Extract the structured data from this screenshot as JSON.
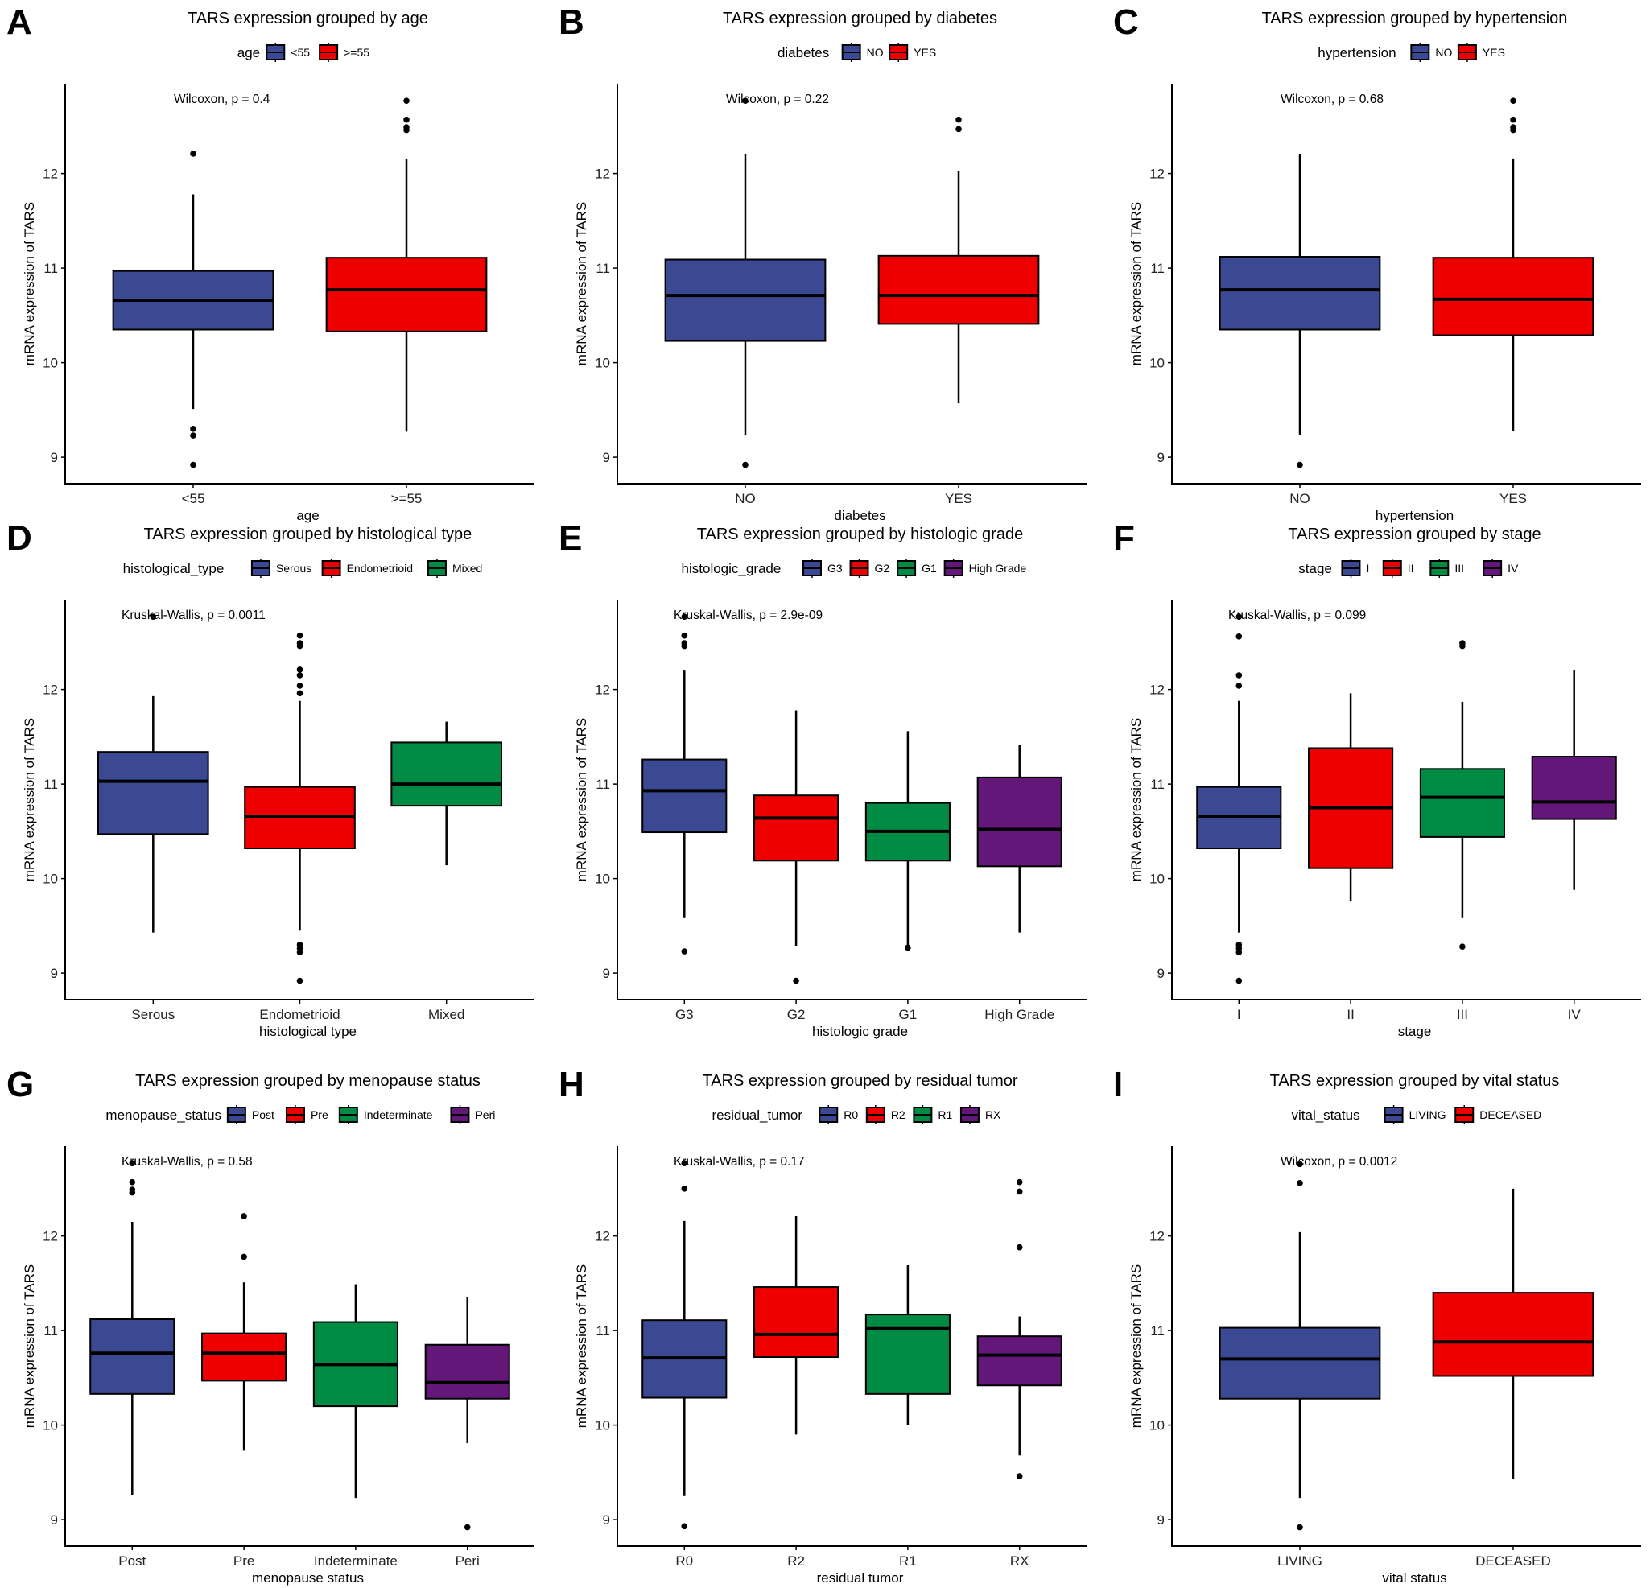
{
  "colors": {
    "blue": "#3B4992",
    "red": "#EE0000",
    "green": "#008B45",
    "purple": "#631879",
    "outline": "#000000"
  },
  "chart_data": [
    {
      "panel_label": "A",
      "type": "box",
      "title": "TARS expression grouped by age",
      "legend_title": "age",
      "legend_position": "top",
      "xlabel": "age",
      "ylabel": "mRNA expression of TARS",
      "ylim": [
        8.72,
        12.95
      ],
      "yticks": [
        9,
        10,
        11,
        12
      ],
      "annotation": "Wilcoxon, p = 0.4",
      "categories": [
        "<55",
        ">=55"
      ],
      "fill": [
        "blue",
        "red"
      ],
      "boxes": [
        {
          "lower_whisker": 9.51,
          "q1": 10.35,
          "median": 10.66,
          "q3": 10.97,
          "upper_whisker": 11.78,
          "outliers": [
            12.21,
            9.3,
            9.23,
            8.92
          ]
        },
        {
          "lower_whisker": 9.27,
          "q1": 10.33,
          "median": 10.77,
          "q3": 11.11,
          "upper_whisker": 12.16,
          "outliers": [
            12.77,
            12.57,
            12.49,
            12.46
          ]
        }
      ]
    },
    {
      "panel_label": "B",
      "type": "box",
      "title": "TARS expression grouped by diabetes",
      "legend_title": "diabetes",
      "legend_position": "top",
      "xlabel": "diabetes",
      "ylabel": "mRNA expression of TARS",
      "ylim": [
        8.72,
        12.95
      ],
      "yticks": [
        9,
        10,
        11,
        12
      ],
      "annotation": "Wilcoxon, p = 0.22",
      "categories": [
        "NO",
        "YES"
      ],
      "fill": [
        "blue",
        "red"
      ],
      "boxes": [
        {
          "lower_whisker": 9.23,
          "q1": 10.23,
          "median": 10.71,
          "q3": 11.09,
          "upper_whisker": 12.21,
          "outliers": [
            12.77,
            8.92
          ]
        },
        {
          "lower_whisker": 9.57,
          "q1": 10.41,
          "median": 10.71,
          "q3": 11.13,
          "upper_whisker": 12.03,
          "outliers": [
            12.57,
            12.47
          ]
        }
      ]
    },
    {
      "panel_label": "C",
      "type": "box",
      "title": "TARS expression grouped by hypertension",
      "legend_title": "hypertension",
      "legend_position": "top",
      "xlabel": "hypertension",
      "ylabel": "mRNA expression of TARS",
      "ylim": [
        8.72,
        12.95
      ],
      "yticks": [
        9,
        10,
        11,
        12
      ],
      "annotation": "Wilcoxon, p = 0.68",
      "categories": [
        "NO",
        "YES"
      ],
      "fill": [
        "blue",
        "red"
      ],
      "boxes": [
        {
          "lower_whisker": 9.24,
          "q1": 10.35,
          "median": 10.77,
          "q3": 11.12,
          "upper_whisker": 12.21,
          "outliers": [
            8.92
          ]
        },
        {
          "lower_whisker": 9.28,
          "q1": 10.29,
          "median": 10.67,
          "q3": 11.11,
          "upper_whisker": 12.16,
          "outliers": [
            12.77,
            12.57,
            12.49,
            12.46
          ]
        }
      ]
    },
    {
      "panel_label": "D",
      "type": "box",
      "title": "TARS expression grouped by histological type",
      "legend_title": "histological_type",
      "legend_position": "top",
      "xlabel": "histological type",
      "ylabel": "mRNA expression of TARS",
      "ylim": [
        8.72,
        12.95
      ],
      "yticks": [
        9,
        10,
        11,
        12
      ],
      "annotation": "Kruskal-Wallis, p = 0.0011",
      "categories": [
        "Serous",
        "Endometrioid",
        "Mixed"
      ],
      "fill": [
        "blue",
        "red",
        "green"
      ],
      "boxes": [
        {
          "lower_whisker": 9.43,
          "q1": 10.47,
          "median": 11.03,
          "q3": 11.34,
          "upper_whisker": 11.93,
          "outliers": [
            12.77
          ]
        },
        {
          "lower_whisker": 9.45,
          "q1": 10.32,
          "median": 10.66,
          "q3": 10.97,
          "upper_whisker": 11.88,
          "outliers": [
            12.57,
            12.49,
            12.46,
            12.21,
            12.15,
            12.04,
            11.96,
            9.3,
            9.26,
            9.22,
            8.92
          ]
        },
        {
          "lower_whisker": 10.14,
          "q1": 10.77,
          "median": 11.0,
          "q3": 11.44,
          "upper_whisker": 11.66,
          "outliers": []
        }
      ]
    },
    {
      "panel_label": "E",
      "type": "box",
      "title": "TARS expression grouped by histologic grade",
      "legend_title": "histologic_grade",
      "legend_position": "top",
      "xlabel": "histologic grade",
      "ylabel": "mRNA expression of TARS",
      "ylim": [
        8.72,
        12.95
      ],
      "yticks": [
        9,
        10,
        11,
        12
      ],
      "annotation": "Kruskal-Wallis, p = 2.9e-09",
      "categories": [
        "G3",
        "G2",
        "G1",
        "High Grade"
      ],
      "fill": [
        "blue",
        "red",
        "green",
        "purple"
      ],
      "boxes": [
        {
          "lower_whisker": 9.59,
          "q1": 10.49,
          "median": 10.93,
          "q3": 11.26,
          "upper_whisker": 12.2,
          "outliers": [
            12.77,
            12.57,
            12.49,
            12.46,
            9.23
          ]
        },
        {
          "lower_whisker": 9.29,
          "q1": 10.19,
          "median": 10.64,
          "q3": 10.88,
          "upper_whisker": 11.78,
          "outliers": [
            8.92
          ]
        },
        {
          "lower_whisker": 9.28,
          "q1": 10.19,
          "median": 10.5,
          "q3": 10.8,
          "upper_whisker": 11.56,
          "outliers": [
            9.27
          ]
        },
        {
          "lower_whisker": 9.43,
          "q1": 10.13,
          "median": 10.52,
          "q3": 11.07,
          "upper_whisker": 11.41,
          "outliers": []
        }
      ]
    },
    {
      "panel_label": "F",
      "type": "box",
      "title": "TARS expression grouped by stage",
      "legend_title": "stage",
      "legend_position": "top",
      "xlabel": "stage",
      "ylabel": "mRNA expression of TARS",
      "ylim": [
        8.72,
        12.95
      ],
      "yticks": [
        9,
        10,
        11,
        12
      ],
      "annotation": "Kruskal-Wallis, p = 0.099",
      "categories": [
        "I",
        "II",
        "III",
        "IV"
      ],
      "fill": [
        "blue",
        "red",
        "green",
        "purple"
      ],
      "boxes": [
        {
          "lower_whisker": 9.43,
          "q1": 10.32,
          "median": 10.66,
          "q3": 10.97,
          "upper_whisker": 11.88,
          "outliers": [
            12.77,
            12.56,
            12.15,
            12.04,
            9.3,
            9.26,
            9.22,
            8.92
          ]
        },
        {
          "lower_whisker": 9.76,
          "q1": 10.11,
          "median": 10.75,
          "q3": 11.38,
          "upper_whisker": 11.96,
          "outliers": []
        },
        {
          "lower_whisker": 9.59,
          "q1": 10.44,
          "median": 10.86,
          "q3": 11.16,
          "upper_whisker": 11.87,
          "outliers": [
            12.49,
            12.46,
            9.28
          ]
        },
        {
          "lower_whisker": 9.88,
          "q1": 10.63,
          "median": 10.81,
          "q3": 11.29,
          "upper_whisker": 12.2,
          "outliers": []
        }
      ]
    },
    {
      "panel_label": "G",
      "type": "box",
      "title": "TARS expression grouped by menopause status",
      "legend_title": "menopause_status",
      "legend_position": "top",
      "xlabel": "menopause status",
      "ylabel": "mRNA expression of TARS",
      "ylim": [
        8.72,
        12.95
      ],
      "yticks": [
        9,
        10,
        11,
        12
      ],
      "annotation": "Kruskal-Wallis, p = 0.58",
      "categories": [
        "Post",
        "Pre",
        "Indeterminate",
        "Peri"
      ],
      "fill": [
        "blue",
        "red",
        "green",
        "purple"
      ],
      "boxes": [
        {
          "lower_whisker": 9.26,
          "q1": 10.33,
          "median": 10.76,
          "q3": 11.12,
          "upper_whisker": 12.15,
          "outliers": [
            12.77,
            12.57,
            12.49,
            12.46
          ]
        },
        {
          "lower_whisker": 9.73,
          "q1": 10.47,
          "median": 10.76,
          "q3": 10.97,
          "upper_whisker": 11.51,
          "outliers": [
            12.21,
            11.78
          ]
        },
        {
          "lower_whisker": 9.23,
          "q1": 10.2,
          "median": 10.64,
          "q3": 11.09,
          "upper_whisker": 11.49,
          "outliers": []
        },
        {
          "lower_whisker": 9.81,
          "q1": 10.28,
          "median": 10.45,
          "q3": 10.85,
          "upper_whisker": 11.35,
          "outliers": [
            8.92
          ]
        }
      ]
    },
    {
      "panel_label": "H",
      "type": "box",
      "title": "TARS expression grouped by residual tumor",
      "legend_title": "residual_tumor",
      "legend_position": "top",
      "xlabel": "residual tumor",
      "ylabel": "mRNA expression of TARS",
      "ylim": [
        8.72,
        12.95
      ],
      "yticks": [
        9,
        10,
        11,
        12
      ],
      "annotation": "Kruskal-Wallis, p = 0.17",
      "categories": [
        "R0",
        "R2",
        "R1",
        "RX"
      ],
      "fill": [
        "blue",
        "red",
        "green",
        "purple"
      ],
      "boxes": [
        {
          "lower_whisker": 9.25,
          "q1": 10.29,
          "median": 10.71,
          "q3": 11.11,
          "upper_whisker": 12.16,
          "outliers": [
            12.77,
            12.5,
            8.93
          ]
        },
        {
          "lower_whisker": 9.9,
          "q1": 10.72,
          "median": 10.96,
          "q3": 11.46,
          "upper_whisker": 12.21,
          "outliers": []
        },
        {
          "lower_whisker": 10.0,
          "q1": 10.33,
          "median": 11.02,
          "q3": 11.17,
          "upper_whisker": 11.69,
          "outliers": []
        },
        {
          "lower_whisker": 9.68,
          "q1": 10.42,
          "median": 10.74,
          "q3": 10.94,
          "upper_whisker": 11.15,
          "outliers": [
            12.57,
            12.47,
            11.88,
            9.46
          ]
        }
      ]
    },
    {
      "panel_label": "I",
      "type": "box",
      "title": "TARS expression grouped by vital status",
      "legend_title": "vital_status",
      "legend_position": "top",
      "xlabel": "vital status",
      "ylabel": "mRNA expression of TARS",
      "ylim": [
        8.72,
        12.95
      ],
      "yticks": [
        9,
        10,
        11,
        12
      ],
      "annotation": "Wilcoxon, p = 0.0012",
      "categories": [
        "LIVING",
        "DECEASED"
      ],
      "fill": [
        "blue",
        "red"
      ],
      "boxes": [
        {
          "lower_whisker": 9.23,
          "q1": 10.28,
          "median": 10.7,
          "q3": 11.03,
          "upper_whisker": 12.04,
          "outliers": [
            12.76,
            12.56,
            8.92
          ]
        },
        {
          "lower_whisker": 9.43,
          "q1": 10.52,
          "median": 10.88,
          "q3": 11.4,
          "upper_whisker": 12.5,
          "outliers": []
        }
      ]
    }
  ]
}
